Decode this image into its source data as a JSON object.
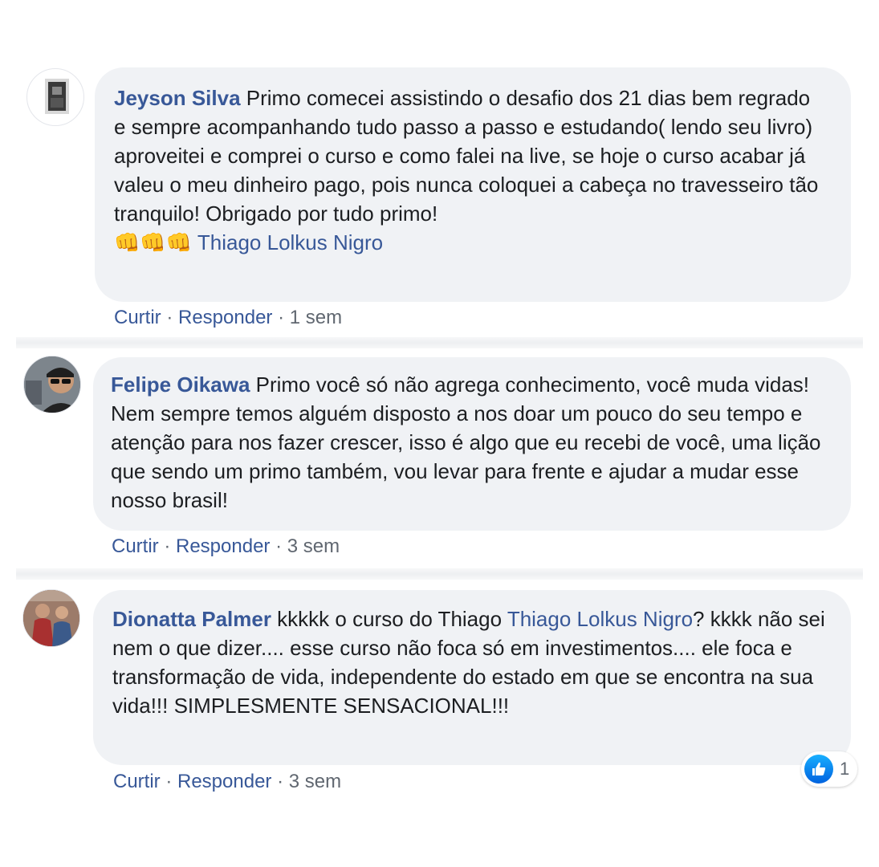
{
  "comments": [
    {
      "author": "Jeyson Silva",
      "text": " Primo comecei assistindo o desafio dos 21 dias bem regrado e sempre acompanhando tudo passo a passo e estudando( lendo seu livro) aproveitei e comprei o curso e como falei na live, se hoje o curso acabar já valeu o meu dinheiro pago, pois nunca coloquei a cabeça no travesseiro tão tranquilo! Obrigado por tudo primo!",
      "emojis": "👊👊👊",
      "mention": "Thiago Lolkus Nigro",
      "like_label": "Curtir",
      "reply_label": "Responder",
      "separator": " · ",
      "time": "1 sem"
    },
    {
      "author": "Felipe Oikawa",
      "text": " Primo você só não agrega conhecimento, você muda vidas! Nem sempre temos alguém disposto a nos doar um pouco do seu tempo e atenção para nos fazer crescer, isso é algo que eu recebi de você, uma lição que sendo um primo também, vou levar para frente e ajudar a mudar esse nosso brasil!",
      "like_label": "Curtir",
      "reply_label": "Responder",
      "separator": " · ",
      "time": "3 sem"
    },
    {
      "author": "Dionatta Palmer",
      "text_before": " kkkkk o curso do Thiago ",
      "mention": "Thiago Lolkus Nigro",
      "text_after": "? kkkk não sei nem o que dizer.... esse curso não foca só em investimentos.... ele foca e transformação de vida, independente do estado em que se encontra na sua vida!!! SIMPLESMENTE SENSACIONAL!!!",
      "like_label": "Curtir",
      "reply_label": "Responder",
      "separator": " · ",
      "time": "3 sem",
      "reaction_icon": "like-icon",
      "reaction_count": "1"
    }
  ],
  "colors": {
    "bubble": "#f0f2f5",
    "link": "#385898",
    "text": "#1c1e21",
    "meta": "#606770"
  }
}
